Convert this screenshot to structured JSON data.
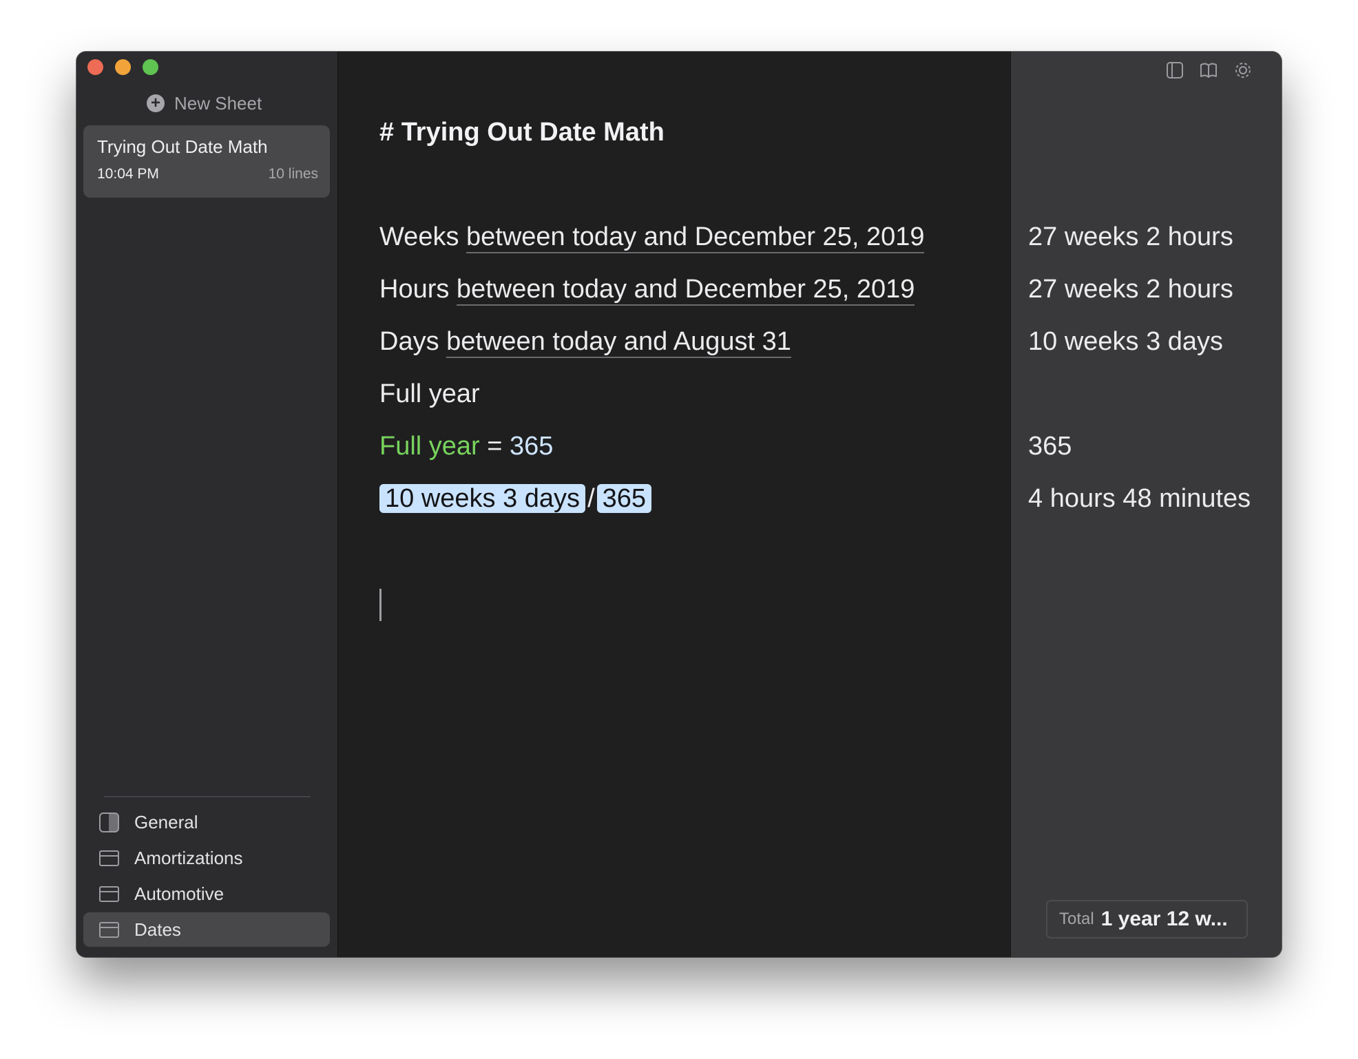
{
  "sidebar": {
    "new_sheet_label": "New Sheet",
    "sheet": {
      "title": "Trying Out Date Math",
      "time": "10:04 PM",
      "lines": "10 lines"
    },
    "folders": [
      {
        "label": "General",
        "icon": "general-icon"
      },
      {
        "label": "Amortizations",
        "icon": "folder-icon"
      },
      {
        "label": "Automotive",
        "icon": "folder-icon"
      },
      {
        "label": "Dates",
        "icon": "folder-icon",
        "selected": true
      }
    ]
  },
  "editor": {
    "heading": "# Trying Out Date Math",
    "lines": [
      {
        "prefix": "Weeks ",
        "underlined": "between today and December 25, 2019"
      },
      {
        "prefix": "Hours ",
        "underlined": "between today and December 25, 2019"
      },
      {
        "prefix": "Days ",
        "underlined": "between today and August 31"
      },
      {
        "text": "Full year"
      },
      {
        "variable": "Full year",
        "operator": " = ",
        "number": "365"
      },
      {
        "token_a": "10 weeks 3 days",
        "operator": "/",
        "token_b": "365"
      }
    ]
  },
  "results": {
    "values": [
      "27 weeks 2 hours",
      "27 weeks 2 hours",
      "10 weeks 3 days",
      "",
      "365",
      "4 hours 48 minutes"
    ],
    "total_label": "Total",
    "total_value": "1 year 12 w..."
  },
  "toolbar_icons": [
    "sidebar-toggle-icon",
    "book-icon",
    "gear-icon"
  ],
  "colors": {
    "variable": "#78d35d",
    "number": "#cfe5ff",
    "token_highlight": "#c9e3ff",
    "editor_bg": "#1f1f20",
    "sidebar_bg": "#2c2c2f",
    "results_bg": "#39393b"
  }
}
